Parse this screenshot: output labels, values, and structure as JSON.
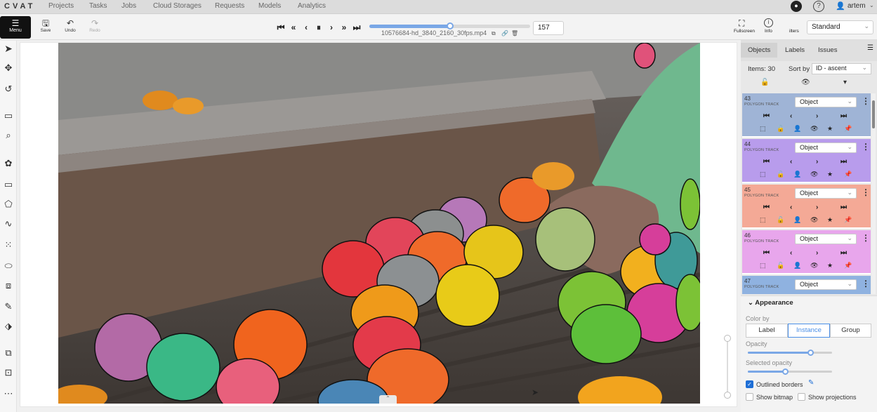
{
  "nav": {
    "logo": "CVAT",
    "items": [
      "Projects",
      "Tasks",
      "Jobs",
      "Cloud Storages",
      "Requests",
      "Models",
      "Analytics"
    ],
    "user": "artem"
  },
  "toolbar": {
    "menu_label": "Menu",
    "save_label": "Save",
    "undo_label": "Undo",
    "redo_label": "Redo",
    "filename": "10576684-hd_3840_2160_30fps.mp4",
    "frame_number": "157",
    "frame_progress": 0.5,
    "fullscreen_label": "Fullscreen",
    "info_label": "Info",
    "filters_label": "ilters",
    "workspace": "Standard"
  },
  "sidebar": {
    "tabs": [
      "Objects",
      "Labels",
      "Issues"
    ],
    "items_label": "Items: 30",
    "sort_label": "Sort by",
    "sort_value": "ID - ascent",
    "objects": [
      {
        "id": "43",
        "type": "POLYGON TRACK",
        "label": "Object",
        "color": "#9fb4d6"
      },
      {
        "id": "44",
        "type": "POLYGON TRACK",
        "label": "Object",
        "color": "#b89cec"
      },
      {
        "id": "45",
        "type": "POLYGON TRACK",
        "label": "Object",
        "color": "#f4a996"
      },
      {
        "id": "46",
        "type": "POLYGON TRACK",
        "label": "Object",
        "color": "#e8a6ec"
      },
      {
        "id": "47",
        "type": "POLYGON TRACK",
        "label": "Object",
        "color": "#8fb2e0"
      }
    ]
  },
  "appearance": {
    "title": "Appearance",
    "color_by_label": "Color by",
    "color_by_options": [
      "Label",
      "Instance",
      "Group"
    ],
    "color_by_selected": "Instance",
    "opacity_label": "Opacity",
    "opacity_value": 0.75,
    "selected_opacity_label": "Selected opacity",
    "selected_opacity_value": 0.45,
    "outlined_borders_label": "Outlined borders",
    "outlined_borders_checked": true,
    "show_bitmap_label": "Show bitmap",
    "show_projections_label": "Show projections"
  }
}
